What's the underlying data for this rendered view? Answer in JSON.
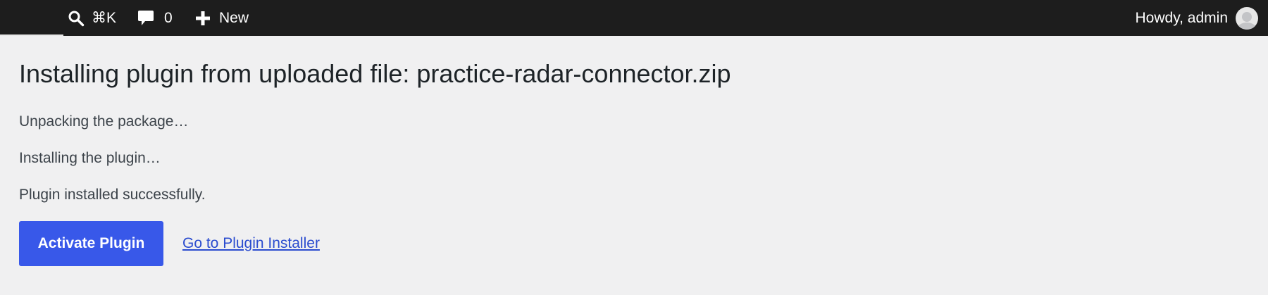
{
  "admin_bar": {
    "search_shortcut": "⌘K",
    "comments_count": "0",
    "new_label": "New",
    "greeting": "Howdy, admin"
  },
  "main": {
    "title": "Installing plugin from uploaded file: practice-radar-connector.zip",
    "messages": [
      "Unpacking the package…",
      "Installing the plugin…",
      "Plugin installed successfully."
    ],
    "activate_button": "Activate Plugin",
    "installer_link": "Go to Plugin Installer"
  },
  "colors": {
    "admin_bar_bg": "#1d1d1d",
    "page_bg": "#f0f0f1",
    "primary_button": "#3858e9",
    "link": "#2b4ccf"
  },
  "icons": {
    "search": "search-icon",
    "comments": "comment-bubble-icon",
    "new": "plus-icon",
    "avatar": "user-avatar-icon"
  }
}
